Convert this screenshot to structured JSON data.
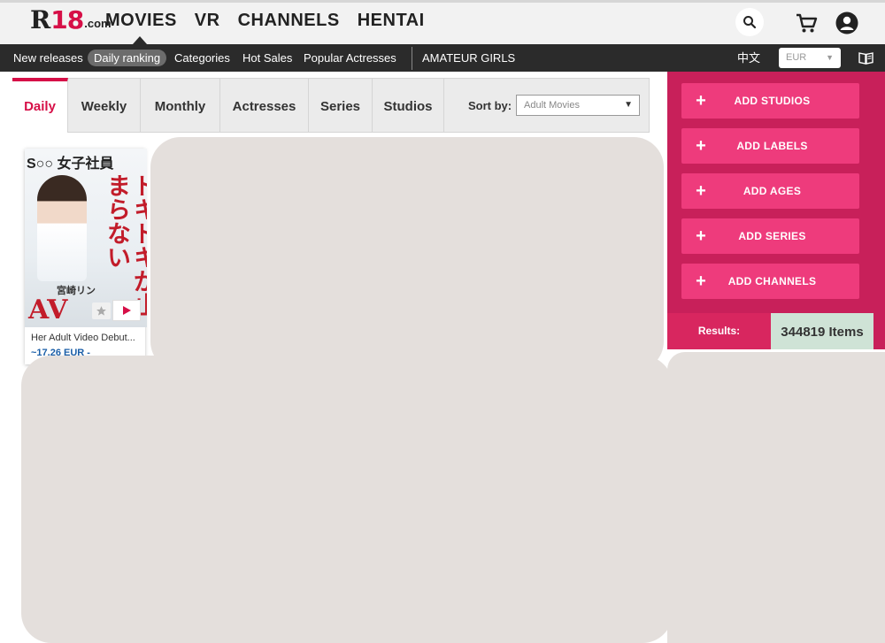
{
  "header": {
    "logo": {
      "main": "R",
      "num": "18",
      "suffix": ".com"
    },
    "nav": [
      "MOVIES",
      "VR",
      "CHANNELS",
      "HENTAI"
    ]
  },
  "subnav": {
    "items": [
      "New releases",
      "Daily ranking",
      "Categories",
      "Hot Sales",
      "Popular Actresses"
    ],
    "extra": "AMATEUR GIRLS",
    "language": "中文",
    "currency": "EUR"
  },
  "tabs": [
    "Daily",
    "Weekly",
    "Monthly",
    "Actresses",
    "Series",
    "Studios"
  ],
  "sort": {
    "label": "Sort by:",
    "value": "Adult Movies"
  },
  "sidebar": {
    "buttons": [
      "ADD STUDIOS",
      "ADD LABELS",
      "ADD AGES",
      "ADD SERIES",
      "ADD CHANNELS"
    ],
    "results_label": "Results:",
    "results_count": "344819 Items"
  },
  "product": {
    "cover_top": "S○○ 女子社員",
    "cover_vertical": "ドキドキが止まらない",
    "cover_name": "宮崎リン",
    "cover_av": "AV",
    "title": "Her Adult Video Debut...",
    "price": "~17.26 EUR -"
  },
  "colors": {
    "brand": "#d60f47",
    "sidebar_bg": "#c8205a",
    "add_button": "#ee3b7c",
    "count_bg": "#cfe3d6",
    "price": "#1b5fa8"
  }
}
